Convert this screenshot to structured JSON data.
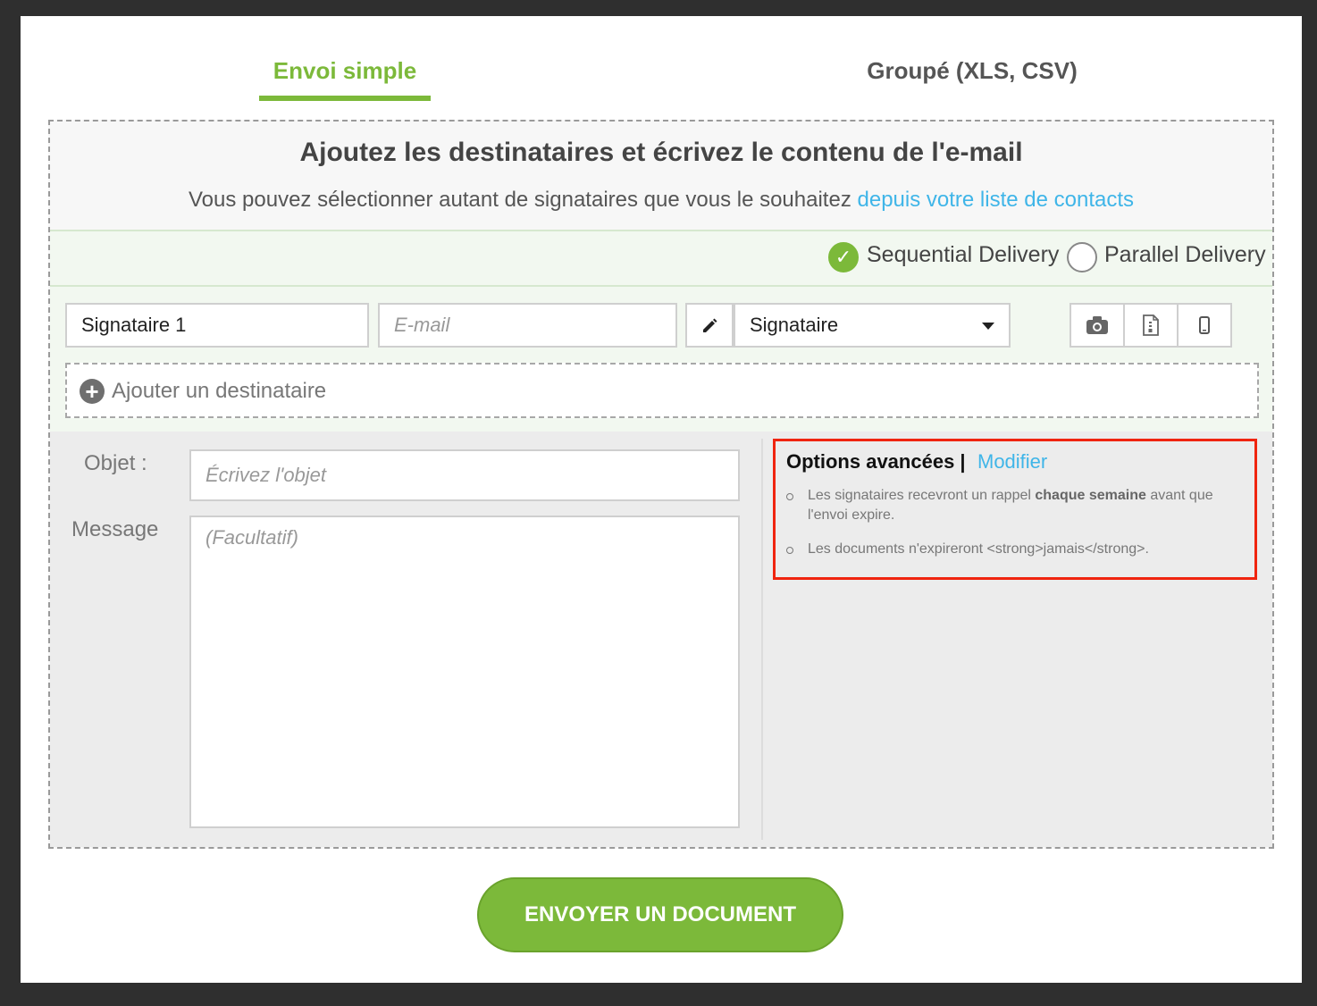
{
  "tabs": [
    {
      "label": "Envoi simple",
      "active": true
    },
    {
      "label": "Groupé (XLS, CSV)",
      "active": false
    }
  ],
  "header": {
    "title": "Ajoutez les destinataires et écrivez le contenu de l'e-mail",
    "subtitle": "Vous pouvez sélectionner autant de signataires que vous le souhaitez",
    "subtitle_link": "depuis votre liste de contacts"
  },
  "delivery": {
    "sequential_label": "Sequential Delivery",
    "parallel_label": "Parallel Delivery",
    "selected": "sequential"
  },
  "recipient": {
    "name_value": "Signataire 1",
    "email_placeholder": "E-mail",
    "role_selected": "Signataire"
  },
  "add_recipient_label": "Ajouter un destinataire",
  "form": {
    "subject_label": "Objet :",
    "subject_placeholder": "Écrivez l'objet",
    "message_label": "Message",
    "message_placeholder": "(Facultatif)"
  },
  "options": {
    "title": "Options avancées |",
    "edit_link": "Modifier",
    "item1_pre": "Les signataires recevront un rappel",
    "item1_bold": "chaque semaine",
    "item1_post": "avant que l'envoi expire.",
    "item2": "Les documents n'expireront <strong>jamais</strong>."
  },
  "send_button": "ENVOYER UN DOCUMENT",
  "colors": {
    "accent_green": "#7cb93a",
    "link_blue": "#3fb5e8",
    "highlight_red": "#f0240f"
  }
}
